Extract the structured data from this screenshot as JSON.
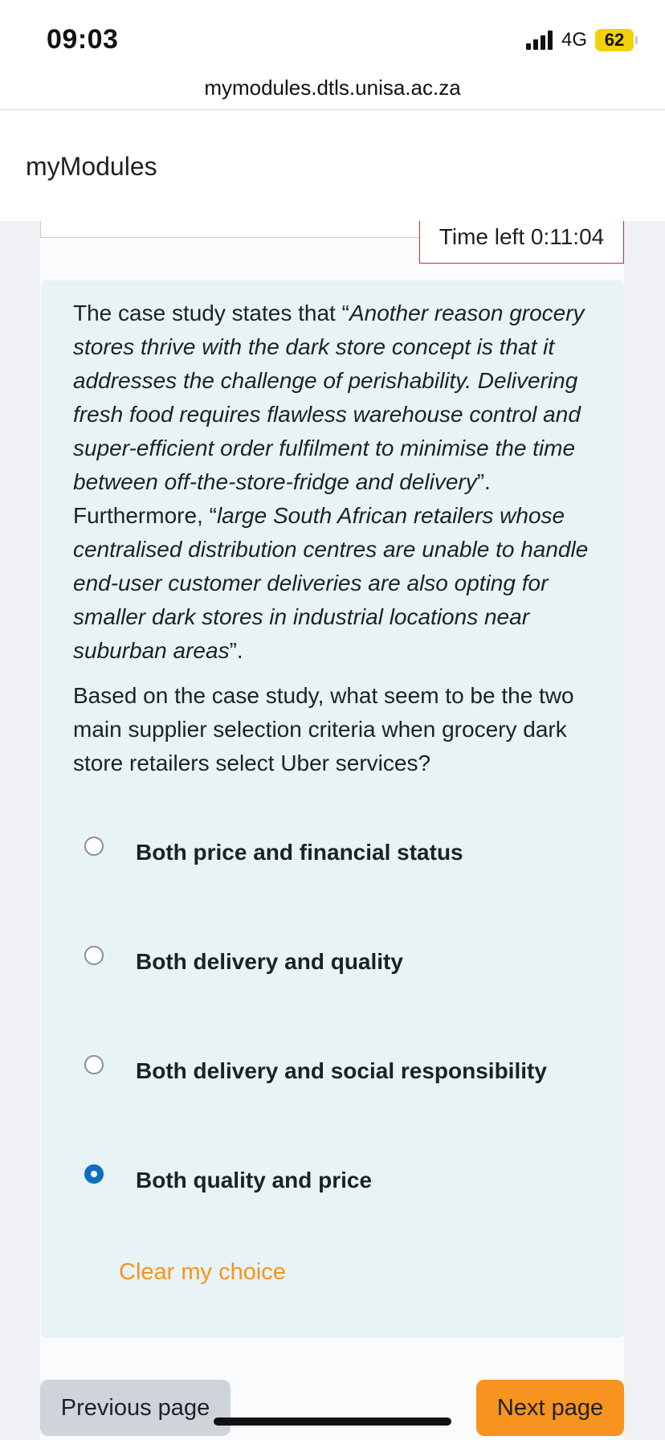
{
  "status_bar": {
    "time": "09:03",
    "network": "4G",
    "battery": "62",
    "battery_color": "#f4d20b"
  },
  "browser": {
    "url": "mymodules.dtls.unisa.ac.za"
  },
  "header": {
    "site_name": "myModules"
  },
  "timer": {
    "text": "Time left 0:11:04"
  },
  "question": {
    "intro_before": "The case study states that “",
    "quote1": "Another reason grocery stores thrive with the dark store concept is that it addresses the challenge of perishability. Delivering fresh food requires flawless warehouse control and super-efficient order fulfilment to minimise the time between off-the-store-fridge and delivery",
    "middle": "”. Furthermore, “",
    "quote2": "large South African retailers whose centralised distribution centres are unable to handle end-user customer deliveries are also opting for smaller dark stores in industrial locations near suburban areas",
    "end": "”.",
    "prompt": "Based on the case study, what seem to be the two main supplier selection criteria when grocery dark store retailers select Uber services?",
    "options": [
      {
        "label": "Both price and financial status",
        "selected": false
      },
      {
        "label": "Both delivery and quality",
        "selected": false
      },
      {
        "label": "Both delivery and social responsibility",
        "selected": false
      },
      {
        "label": "Both quality and price",
        "selected": true
      }
    ],
    "clear_label": "Clear my choice"
  },
  "navigation": {
    "previous_label": "Previous page",
    "next_label": "Next page"
  },
  "colors": {
    "accent": "#f7931e",
    "selected_radio": "#0f6cbf",
    "card_background": "#e7f3f5",
    "timer_border": "#ca3120"
  }
}
